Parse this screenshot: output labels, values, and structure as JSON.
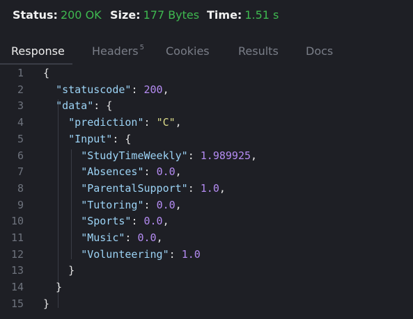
{
  "status": {
    "status_label": "Status:",
    "status_value": "200 OK",
    "size_label": "Size:",
    "size_value": "177 Bytes",
    "time_label": "Time:",
    "time_value": "1.51 s"
  },
  "tabs": [
    {
      "label": "Response",
      "active": true
    },
    {
      "label": "Headers",
      "badge": "5",
      "active": false
    },
    {
      "label": "Cookies",
      "active": false
    },
    {
      "label": "Results",
      "active": false
    },
    {
      "label": "Docs",
      "active": false
    }
  ],
  "code_lines": [
    {
      "n": "1",
      "tokens": [
        {
          "t": "{",
          "c": "punct"
        }
      ]
    },
    {
      "n": "2",
      "tokens": [
        {
          "t": "  ",
          "c": "punct"
        },
        {
          "t": "\"statuscode\"",
          "c": "key"
        },
        {
          "t": ": ",
          "c": "punct"
        },
        {
          "t": "200",
          "c": "num"
        },
        {
          "t": ",",
          "c": "punct"
        }
      ]
    },
    {
      "n": "3",
      "tokens": [
        {
          "t": "  ",
          "c": "punct"
        },
        {
          "t": "\"data\"",
          "c": "key"
        },
        {
          "t": ": {",
          "c": "punct"
        }
      ]
    },
    {
      "n": "4",
      "tokens": [
        {
          "t": "    ",
          "c": "punct"
        },
        {
          "t": "\"prediction\"",
          "c": "key"
        },
        {
          "t": ": ",
          "c": "punct"
        },
        {
          "t": "\"C\"",
          "c": "str"
        },
        {
          "t": ",",
          "c": "punct"
        }
      ]
    },
    {
      "n": "5",
      "tokens": [
        {
          "t": "    ",
          "c": "punct"
        },
        {
          "t": "\"Input\"",
          "c": "key"
        },
        {
          "t": ": {",
          "c": "punct"
        }
      ]
    },
    {
      "n": "6",
      "tokens": [
        {
          "t": "      ",
          "c": "punct"
        },
        {
          "t": "\"StudyTimeWeekly\"",
          "c": "key"
        },
        {
          "t": ": ",
          "c": "punct"
        },
        {
          "t": "1.989925",
          "c": "num"
        },
        {
          "t": ",",
          "c": "punct"
        }
      ]
    },
    {
      "n": "7",
      "tokens": [
        {
          "t": "      ",
          "c": "punct"
        },
        {
          "t": "\"Absences\"",
          "c": "key"
        },
        {
          "t": ": ",
          "c": "punct"
        },
        {
          "t": "0.0",
          "c": "num"
        },
        {
          "t": ",",
          "c": "punct"
        }
      ]
    },
    {
      "n": "8",
      "tokens": [
        {
          "t": "      ",
          "c": "punct"
        },
        {
          "t": "\"ParentalSupport\"",
          "c": "key"
        },
        {
          "t": ": ",
          "c": "punct"
        },
        {
          "t": "1.0",
          "c": "num"
        },
        {
          "t": ",",
          "c": "punct"
        }
      ]
    },
    {
      "n": "9",
      "tokens": [
        {
          "t": "      ",
          "c": "punct"
        },
        {
          "t": "\"Tutoring\"",
          "c": "key"
        },
        {
          "t": ": ",
          "c": "punct"
        },
        {
          "t": "0.0",
          "c": "num"
        },
        {
          "t": ",",
          "c": "punct"
        }
      ]
    },
    {
      "n": "10",
      "tokens": [
        {
          "t": "      ",
          "c": "punct"
        },
        {
          "t": "\"Sports\"",
          "c": "key"
        },
        {
          "t": ": ",
          "c": "punct"
        },
        {
          "t": "0.0",
          "c": "num"
        },
        {
          "t": ",",
          "c": "punct"
        }
      ]
    },
    {
      "n": "11",
      "tokens": [
        {
          "t": "      ",
          "c": "punct"
        },
        {
          "t": "\"Music\"",
          "c": "key"
        },
        {
          "t": ": ",
          "c": "punct"
        },
        {
          "t": "0.0",
          "c": "num"
        },
        {
          "t": ",",
          "c": "punct"
        }
      ]
    },
    {
      "n": "12",
      "tokens": [
        {
          "t": "      ",
          "c": "punct"
        },
        {
          "t": "\"Volunteering\"",
          "c": "key"
        },
        {
          "t": ": ",
          "c": "punct"
        },
        {
          "t": "1.0",
          "c": "num"
        }
      ]
    },
    {
      "n": "13",
      "tokens": [
        {
          "t": "    }",
          "c": "punct"
        }
      ]
    },
    {
      "n": "14",
      "tokens": [
        {
          "t": "  }",
          "c": "punct"
        }
      ]
    },
    {
      "n": "15",
      "tokens": [
        {
          "t": "}",
          "c": "punct"
        }
      ]
    }
  ]
}
